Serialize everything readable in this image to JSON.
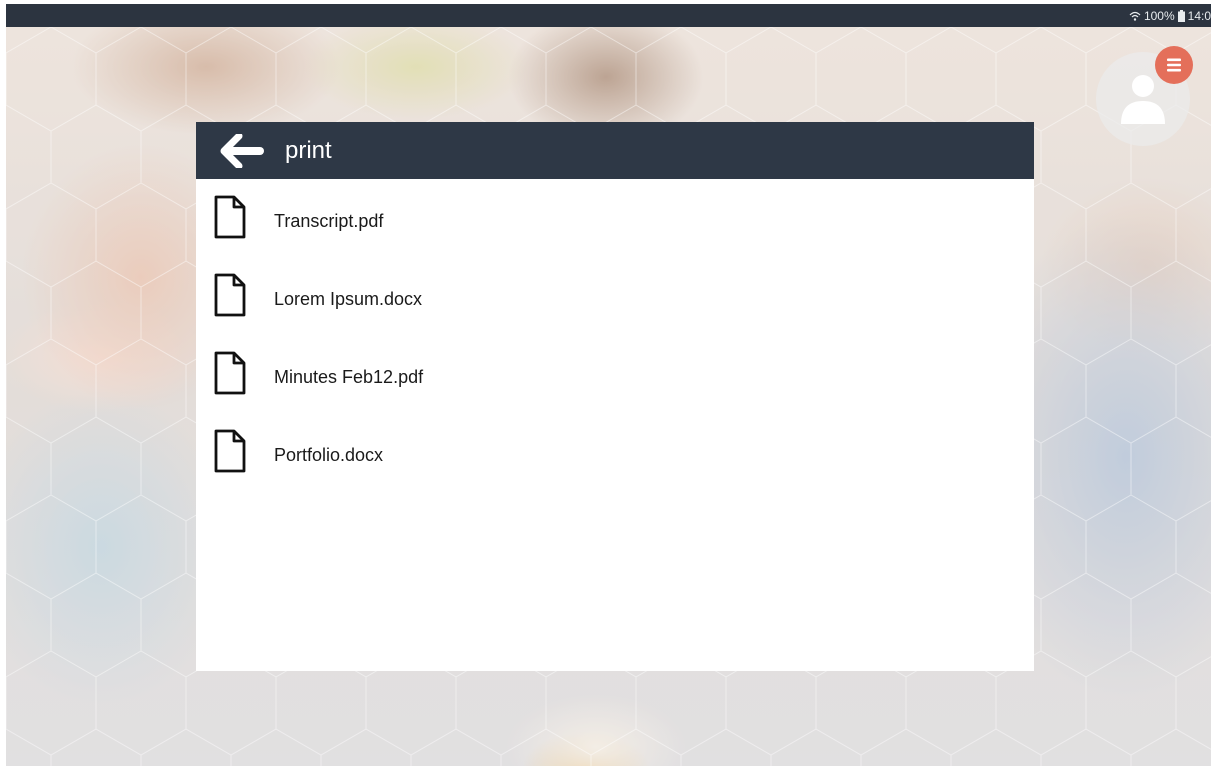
{
  "status_bar": {
    "battery": "100%",
    "time": "14:0",
    "icons": [
      "wifi-icon",
      "battery-icon"
    ]
  },
  "dialog": {
    "title": "print",
    "back_icon": "arrow-left-icon",
    "files": [
      {
        "name": "Transcript.pdf",
        "icon": "document-icon"
      },
      {
        "name": "Lorem Ipsum.docx",
        "icon": "document-icon"
      },
      {
        "name": "Minutes Feb12.pdf",
        "icon": "document-icon"
      },
      {
        "name": "Portfolio.docx",
        "icon": "document-icon"
      }
    ]
  },
  "account": {
    "avatar_icon": "user-icon",
    "menu_icon": "menu-icon"
  },
  "colors": {
    "status_bar": "#2c3440",
    "header": "#2e3846",
    "menu_badge": "#e46f5a",
    "dialog_bg": "#ffffff"
  }
}
